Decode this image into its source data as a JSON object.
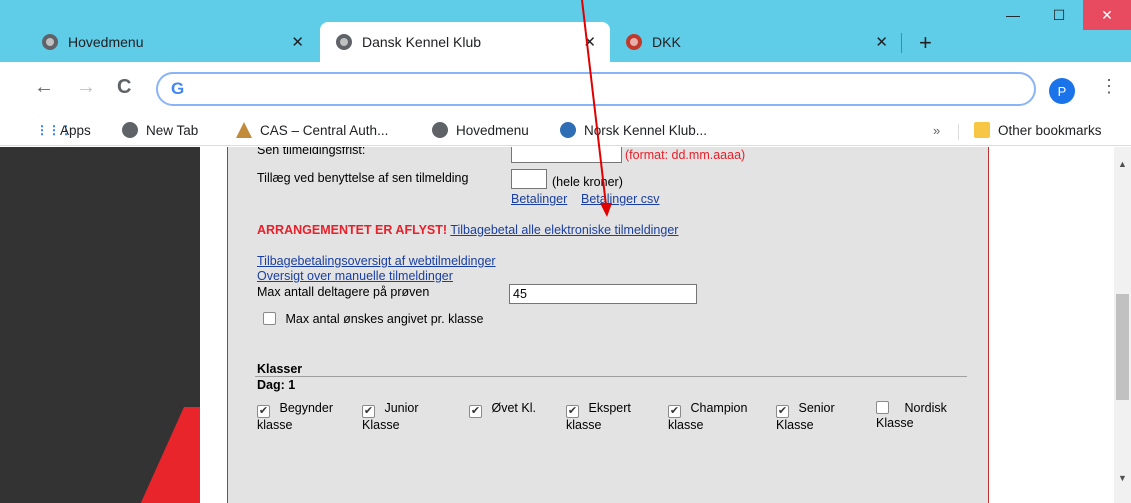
{
  "browser": {
    "tabs": [
      {
        "label": "Hovedmenu",
        "close": "✕"
      },
      {
        "label": "Dansk Kennel Klub",
        "close": "✕"
      },
      {
        "label": "DKK",
        "close": "✕"
      }
    ],
    "new_tab": "+",
    "window": {
      "minimize": "—",
      "maximize": "☐",
      "close": "✕"
    },
    "toolbar": {
      "back": "←",
      "forward": "→",
      "reload": "C",
      "search_logo": "G",
      "profile_initial": "P",
      "menu": "⋮"
    },
    "bookmarks": {
      "items": [
        "Apps",
        "New Tab",
        "CAS – Central Auth...",
        "Hovedmenu",
        "Norsk Kennel Klub..."
      ],
      "overflow": "»",
      "other": "Other bookmarks",
      "apps_icon": "⋮⋮⋮"
    }
  },
  "form": {
    "late_deadline_label": "Sen tilmeldingsfrist:",
    "late_deadline_format": "(format: dd.mm.aaaa)",
    "late_fee_label": "Tillæg ved benyttelse af sen tilmelding",
    "late_fee_unit": "(hele kroner)",
    "payments_link": "Betalinger",
    "payments_csv_link": "Betalinger csv",
    "cancelled_notice": "ARRANGEMENTET ER AFLYST!",
    "refund_all_link": "Tilbagebetal alle elektroniske tilmeldinger",
    "refund_overview_link": "Tilbagebetalingsoversigt af webtilmeldinger",
    "manual_overview_link": "Oversigt over manuelle tilmeldinger",
    "max_participants_label": "Max antall deltagere på prøven",
    "max_participants_value": "45",
    "max_per_class_label": "Max antal ønskes angivet pr. klasse",
    "classes_heading": "Klasser",
    "day_label": "Dag: 1",
    "classes": [
      {
        "line1": "Begynder",
        "line2": "klasse",
        "checked": true
      },
      {
        "line1": "Junior",
        "line2": "Klasse",
        "checked": true
      },
      {
        "line1": "Øvet Kl.",
        "line2": "",
        "checked": true
      },
      {
        "line1": "Ekspert",
        "line2": "klasse",
        "checked": true
      },
      {
        "line1": "Champion",
        "line2": "klasse",
        "checked": true
      },
      {
        "line1": "Senior",
        "line2": "Klasse",
        "checked": true
      },
      {
        "line1": "Nordisk",
        "line2": "Klasse",
        "checked": false
      }
    ]
  },
  "colors": {
    "titlebar": "#5fcde8",
    "cancelled_red": "#e8202a",
    "link": "#1a3fa0",
    "arrow": "#e00000"
  }
}
